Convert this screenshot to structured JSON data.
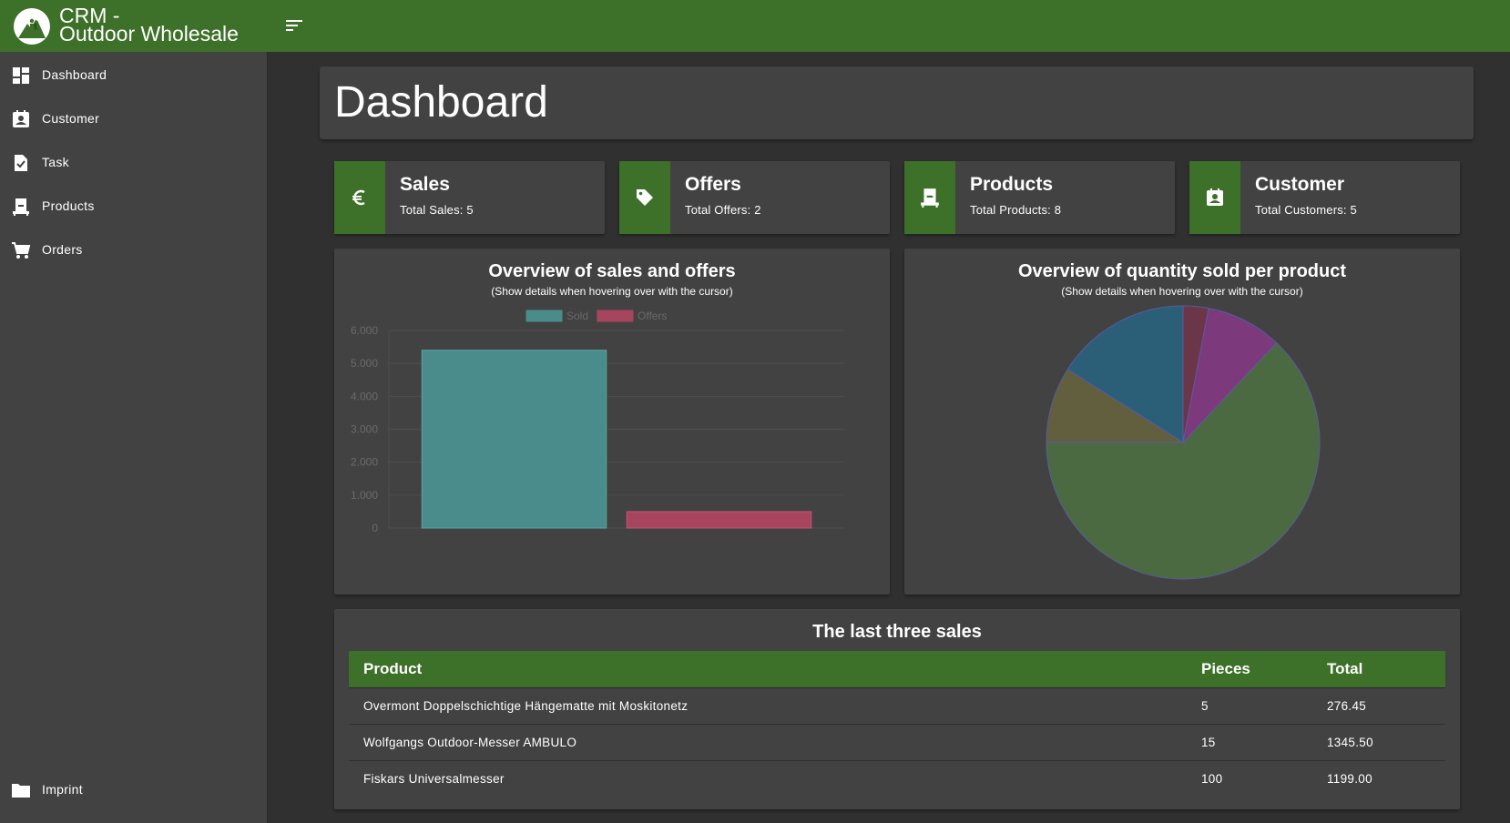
{
  "brand": {
    "title_line1": "CRM -",
    "title_line2": "Outdoor Wholesale"
  },
  "sidebar": {
    "items": [
      {
        "label": "Dashboard",
        "icon": "dashboard-icon"
      },
      {
        "label": "Customer",
        "icon": "contact-card-icon"
      },
      {
        "label": "Task",
        "icon": "task-check-icon"
      },
      {
        "label": "Products",
        "icon": "product-icon"
      },
      {
        "label": "Orders",
        "icon": "cart-icon"
      }
    ],
    "footer_item": {
      "label": "Imprint",
      "icon": "folder-icon"
    }
  },
  "page": {
    "title": "Dashboard"
  },
  "stats": [
    {
      "title": "Sales",
      "sub": "Total Sales: 5",
      "icon": "euro-icon"
    },
    {
      "title": "Offers",
      "sub": "Total Offers: 2",
      "icon": "tag-icon"
    },
    {
      "title": "Products",
      "sub": "Total Products: 8",
      "icon": "product-icon"
    },
    {
      "title": "Customer",
      "sub": "Total Customers: 5",
      "icon": "contact-card-icon"
    }
  ],
  "bar_panel": {
    "title": "Overview of sales and offers",
    "subtitle": "(Show details when hovering over with the cursor)"
  },
  "pie_panel": {
    "title": "Overview of quantity sold per product",
    "subtitle": "(Show details when hovering over with the cursor)"
  },
  "chart_data": [
    {
      "type": "bar",
      "title": "Overview of sales and offers",
      "series": [
        {
          "name": "Sold",
          "values": [
            5400
          ],
          "color": "#4a8c8c"
        },
        {
          "name": "Offers",
          "values": [
            500
          ],
          "color": "#a8455e"
        }
      ],
      "yticks": [
        "0",
        "1.000",
        "2.000",
        "3.000",
        "4.000",
        "5.000",
        "6.000"
      ],
      "ylim": [
        0,
        6000
      ],
      "legend": "top-center",
      "grid": true
    },
    {
      "type": "pie",
      "title": "Overview of quantity sold per product",
      "slices": [
        {
          "value": 3,
          "color": "#6b3647"
        },
        {
          "value": 9,
          "color": "#7c3a7c"
        },
        {
          "value": 63,
          "color": "#4c6a42"
        },
        {
          "value": 9,
          "color": "#625f3f"
        },
        {
          "value": 16,
          "color": "#2b5f78"
        }
      ],
      "slice_border": "#5a5aa0"
    }
  ],
  "sales_table": {
    "title": "The last three sales",
    "headers": [
      "Product",
      "Pieces",
      "Total"
    ],
    "rows": [
      [
        "Overmont Doppelschichtige Hängematte mit Moskitonetz",
        "5",
        "276.45"
      ],
      [
        "Wolfgangs Outdoor-Messer AMBULO",
        "15",
        "1345.50"
      ],
      [
        "Fiskars Universalmesser",
        "100",
        "1199.00"
      ]
    ]
  },
  "colors": {
    "accent": "#3d7028",
    "panel": "#424242",
    "background": "#303030"
  }
}
